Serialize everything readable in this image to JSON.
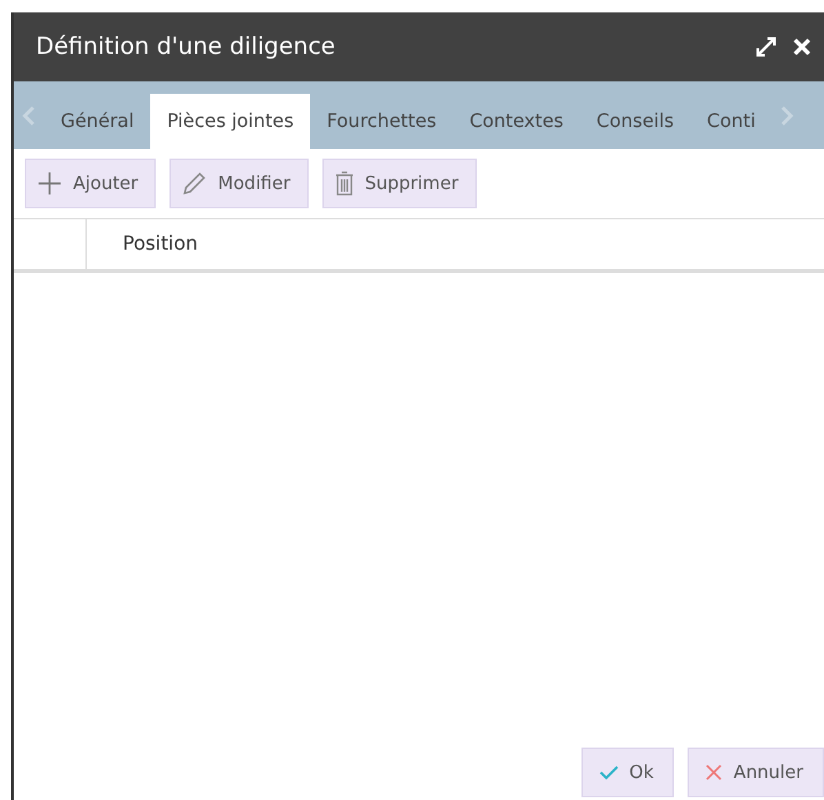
{
  "window": {
    "title": "Définition d'une diligence"
  },
  "tabs": [
    {
      "label": "Général",
      "selected": false
    },
    {
      "label": "Pièces jointes",
      "selected": true
    },
    {
      "label": "Fourchettes",
      "selected": false
    },
    {
      "label": "Contextes",
      "selected": false
    },
    {
      "label": "Conseils",
      "selected": false
    },
    {
      "label": "Conti",
      "selected": false
    }
  ],
  "toolbar": [
    {
      "kind": "add",
      "label": "Ajouter"
    },
    {
      "kind": "edit",
      "label": "Modifier"
    },
    {
      "kind": "delete",
      "label": "Supprimer"
    }
  ],
  "table": {
    "columns": [
      "Position"
    ]
  },
  "buttons": [
    {
      "kind": "ok",
      "label": "Ok"
    },
    {
      "kind": "cancel",
      "label": "Annuler"
    }
  ]
}
